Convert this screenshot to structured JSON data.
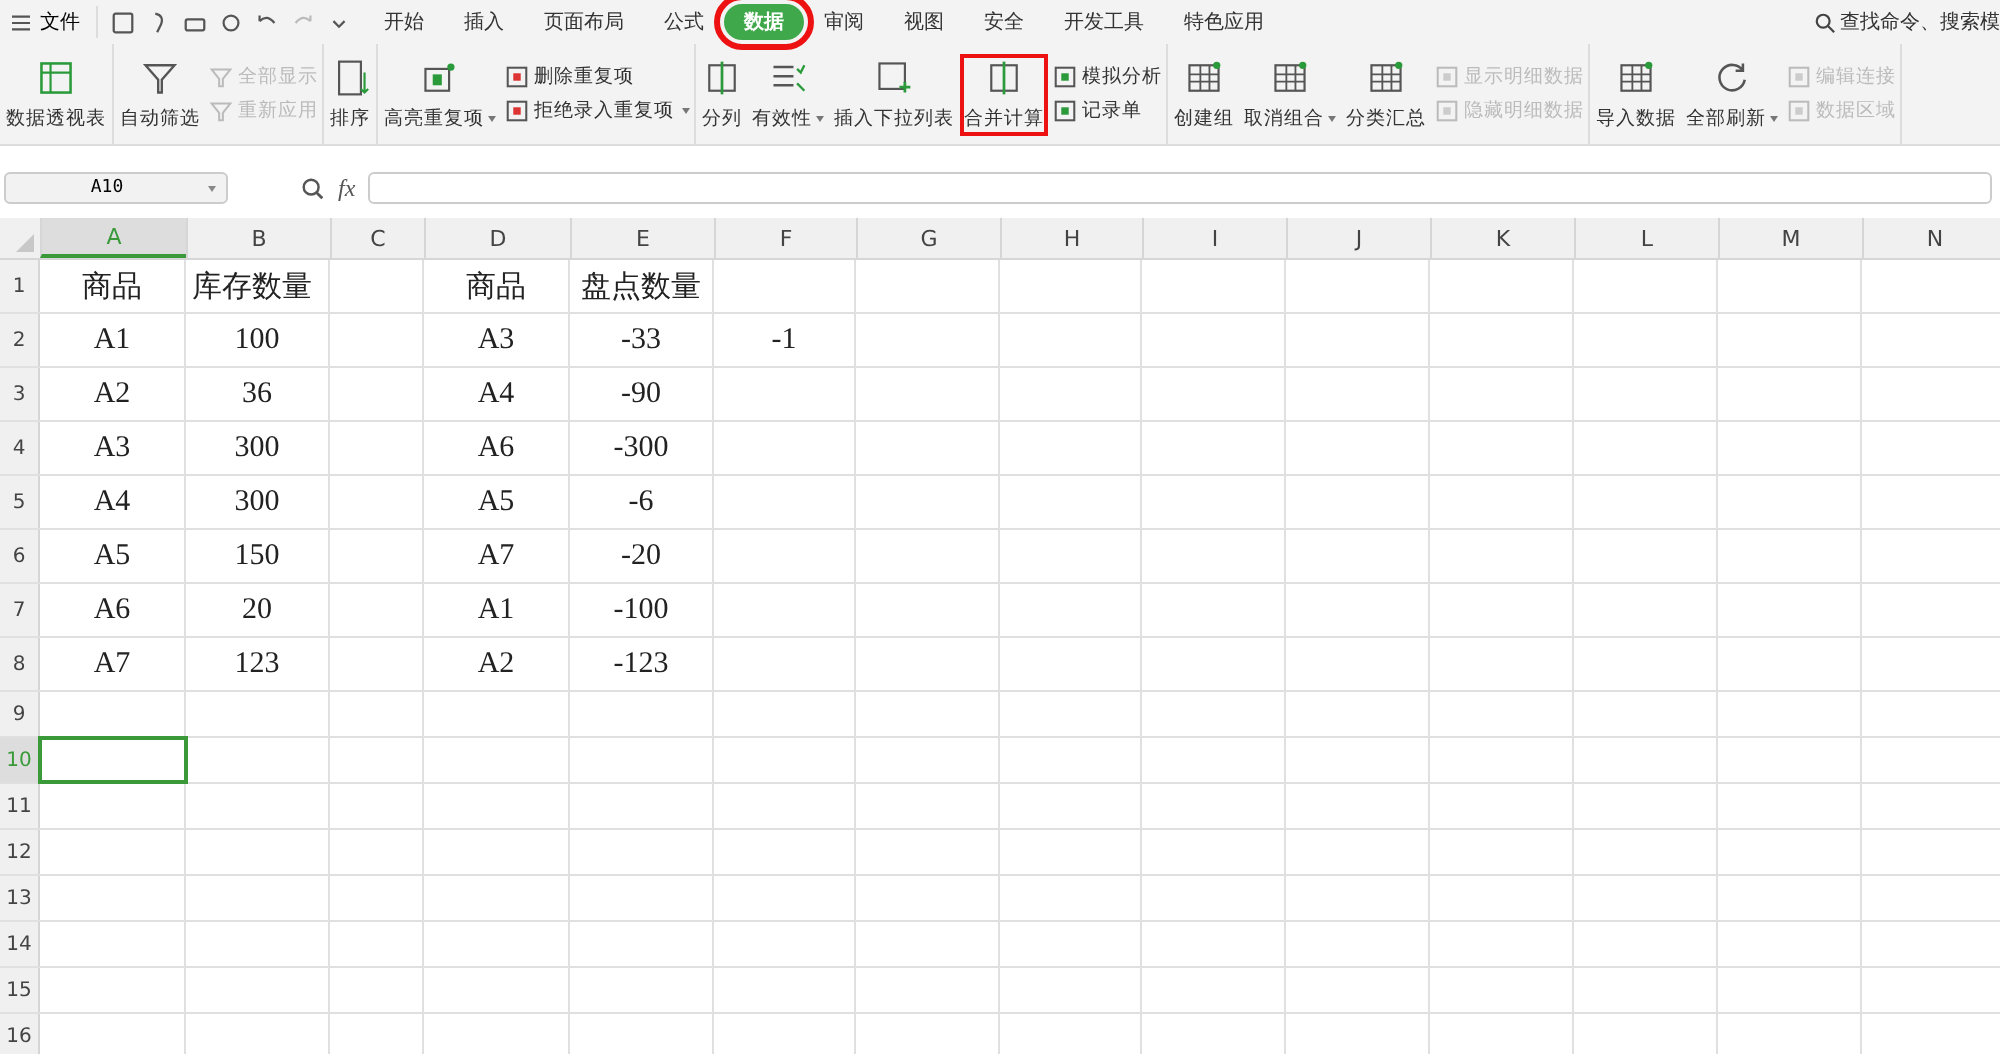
{
  "menu_bar": {
    "file_menu": "文件",
    "tabs": [
      {
        "label": "开始",
        "selected": false,
        "highlighted": false
      },
      {
        "label": "插入",
        "selected": false,
        "highlighted": false
      },
      {
        "label": "页面布局",
        "selected": false,
        "highlighted": false
      },
      {
        "label": "公式",
        "selected": false,
        "highlighted": false
      },
      {
        "label": "数据",
        "selected": true,
        "highlighted": true
      },
      {
        "label": "审阅",
        "selected": false,
        "highlighted": false
      },
      {
        "label": "视图",
        "selected": false,
        "highlighted": false
      },
      {
        "label": "安全",
        "selected": false,
        "highlighted": false
      },
      {
        "label": "开发工具",
        "selected": false,
        "highlighted": false
      },
      {
        "label": "特色应用",
        "selected": false,
        "highlighted": false
      }
    ],
    "search": {
      "placeholder": "查找命令、搜索模"
    }
  },
  "ribbon": [
    {
      "items": [
        {
          "kind": "big",
          "label": "数据透视表",
          "disabled": false,
          "dropdown": false,
          "highlighted": false
        }
      ]
    },
    {
      "items": [
        {
          "kind": "big",
          "label": "自动筛选",
          "disabled": false,
          "dropdown": false,
          "highlighted": false
        },
        {
          "kind": "small",
          "label": "全部显示",
          "disabled": true,
          "dropdown": false,
          "highlighted": false
        },
        {
          "kind": "small",
          "label": "重新应用",
          "disabled": true,
          "dropdown": false,
          "highlighted": false
        }
      ]
    },
    {
      "items": [
        {
          "kind": "big",
          "label": "排序",
          "disabled": false,
          "dropdown": false,
          "highlighted": false
        }
      ]
    },
    {
      "items": [
        {
          "kind": "big",
          "label": "高亮重复项",
          "disabled": false,
          "dropdown": true,
          "highlighted": false
        },
        {
          "kind": "small",
          "label": "删除重复项",
          "disabled": false,
          "dropdown": false,
          "highlighted": false
        },
        {
          "kind": "small",
          "label": "拒绝录入重复项",
          "disabled": false,
          "dropdown": true,
          "highlighted": false
        }
      ]
    },
    {
      "items": [
        {
          "kind": "big",
          "label": "分列",
          "disabled": false,
          "dropdown": false,
          "highlighted": false
        },
        {
          "kind": "big",
          "label": "有效性",
          "disabled": false,
          "dropdown": true,
          "highlighted": false
        },
        {
          "kind": "big",
          "label": "插入下拉列表",
          "disabled": false,
          "dropdown": false,
          "highlighted": false
        },
        {
          "kind": "big",
          "label": "合并计算",
          "disabled": false,
          "dropdown": false,
          "highlighted": true
        },
        {
          "kind": "small",
          "label": "模拟分析",
          "disabled": false,
          "dropdown": false,
          "highlighted": false
        },
        {
          "kind": "small",
          "label": "记录单",
          "disabled": false,
          "dropdown": false,
          "highlighted": false
        }
      ]
    },
    {
      "items": [
        {
          "kind": "big",
          "label": "创建组",
          "disabled": false,
          "dropdown": false,
          "highlighted": false
        },
        {
          "kind": "big",
          "label": "取消组合",
          "disabled": false,
          "dropdown": true,
          "highlighted": false
        },
        {
          "kind": "big",
          "label": "分类汇总",
          "disabled": false,
          "dropdown": false,
          "highlighted": false
        },
        {
          "kind": "small",
          "label": "显示明细数据",
          "disabled": true,
          "dropdown": false,
          "highlighted": false
        },
        {
          "kind": "small",
          "label": "隐藏明细数据",
          "disabled": true,
          "dropdown": false,
          "highlighted": false
        }
      ]
    },
    {
      "items": [
        {
          "kind": "big",
          "label": "导入数据",
          "disabled": false,
          "dropdown": false,
          "highlighted": false
        },
        {
          "kind": "big",
          "label": "全部刷新",
          "disabled": false,
          "dropdown": true,
          "highlighted": false
        },
        {
          "kind": "small",
          "label": "编辑连接",
          "disabled": true,
          "dropdown": false,
          "highlighted": false
        },
        {
          "kind": "small",
          "label": "数据区域",
          "disabled": true,
          "dropdown": false,
          "highlighted": false
        }
      ]
    }
  ],
  "formula_bar": {
    "name_box": "A10",
    "fx": "fx"
  },
  "sheet": {
    "columns": [
      {
        "label": "A",
        "selected": true
      },
      {
        "label": "B",
        "selected": false
      },
      {
        "label": "C",
        "selected": false
      },
      {
        "label": "D",
        "selected": false
      },
      {
        "label": "E",
        "selected": false
      },
      {
        "label": "F",
        "selected": false
      },
      {
        "label": "G",
        "selected": false
      },
      {
        "label": "H",
        "selected": false
      },
      {
        "label": "I",
        "selected": false
      },
      {
        "label": "J",
        "selected": false
      },
      {
        "label": "K",
        "selected": false
      },
      {
        "label": "L",
        "selected": false
      },
      {
        "label": "M",
        "selected": false
      },
      {
        "label": "N",
        "selected": false
      }
    ],
    "rows": [
      {
        "number": "1",
        "selected": false,
        "cells": [
          "商品",
          "库存数量",
          null,
          "商品",
          "盘点数量"
        ]
      },
      {
        "number": "2",
        "selected": false,
        "cells": [
          "A1",
          "100",
          null,
          "A3",
          "-33",
          "-1"
        ]
      },
      {
        "number": "3",
        "selected": false,
        "cells": [
          "A2",
          "36",
          null,
          "A4",
          "-90"
        ]
      },
      {
        "number": "4",
        "selected": false,
        "cells": [
          "A3",
          "300",
          null,
          "A6",
          "-300"
        ]
      },
      {
        "number": "5",
        "selected": false,
        "cells": [
          "A4",
          "300",
          null,
          "A5",
          "-6"
        ]
      },
      {
        "number": "6",
        "selected": false,
        "cells": [
          "A5",
          "150",
          null,
          "A7",
          "-20"
        ]
      },
      {
        "number": "7",
        "selected": false,
        "cells": [
          "A6",
          "20",
          null,
          "A1",
          "-100"
        ]
      },
      {
        "number": "8",
        "selected": false,
        "cells": [
          "A7",
          "123",
          null,
          "A2",
          "-123"
        ]
      },
      {
        "number": "9",
        "selected": false
      },
      {
        "number": "10",
        "selected": true
      },
      {
        "number": "11",
        "selected": false
      },
      {
        "number": "12",
        "selected": false
      },
      {
        "number": "13",
        "selected": false
      },
      {
        "number": "14",
        "selected": false
      },
      {
        "number": "15",
        "selected": false
      },
      {
        "number": "16",
        "selected": false
      }
    ]
  }
}
